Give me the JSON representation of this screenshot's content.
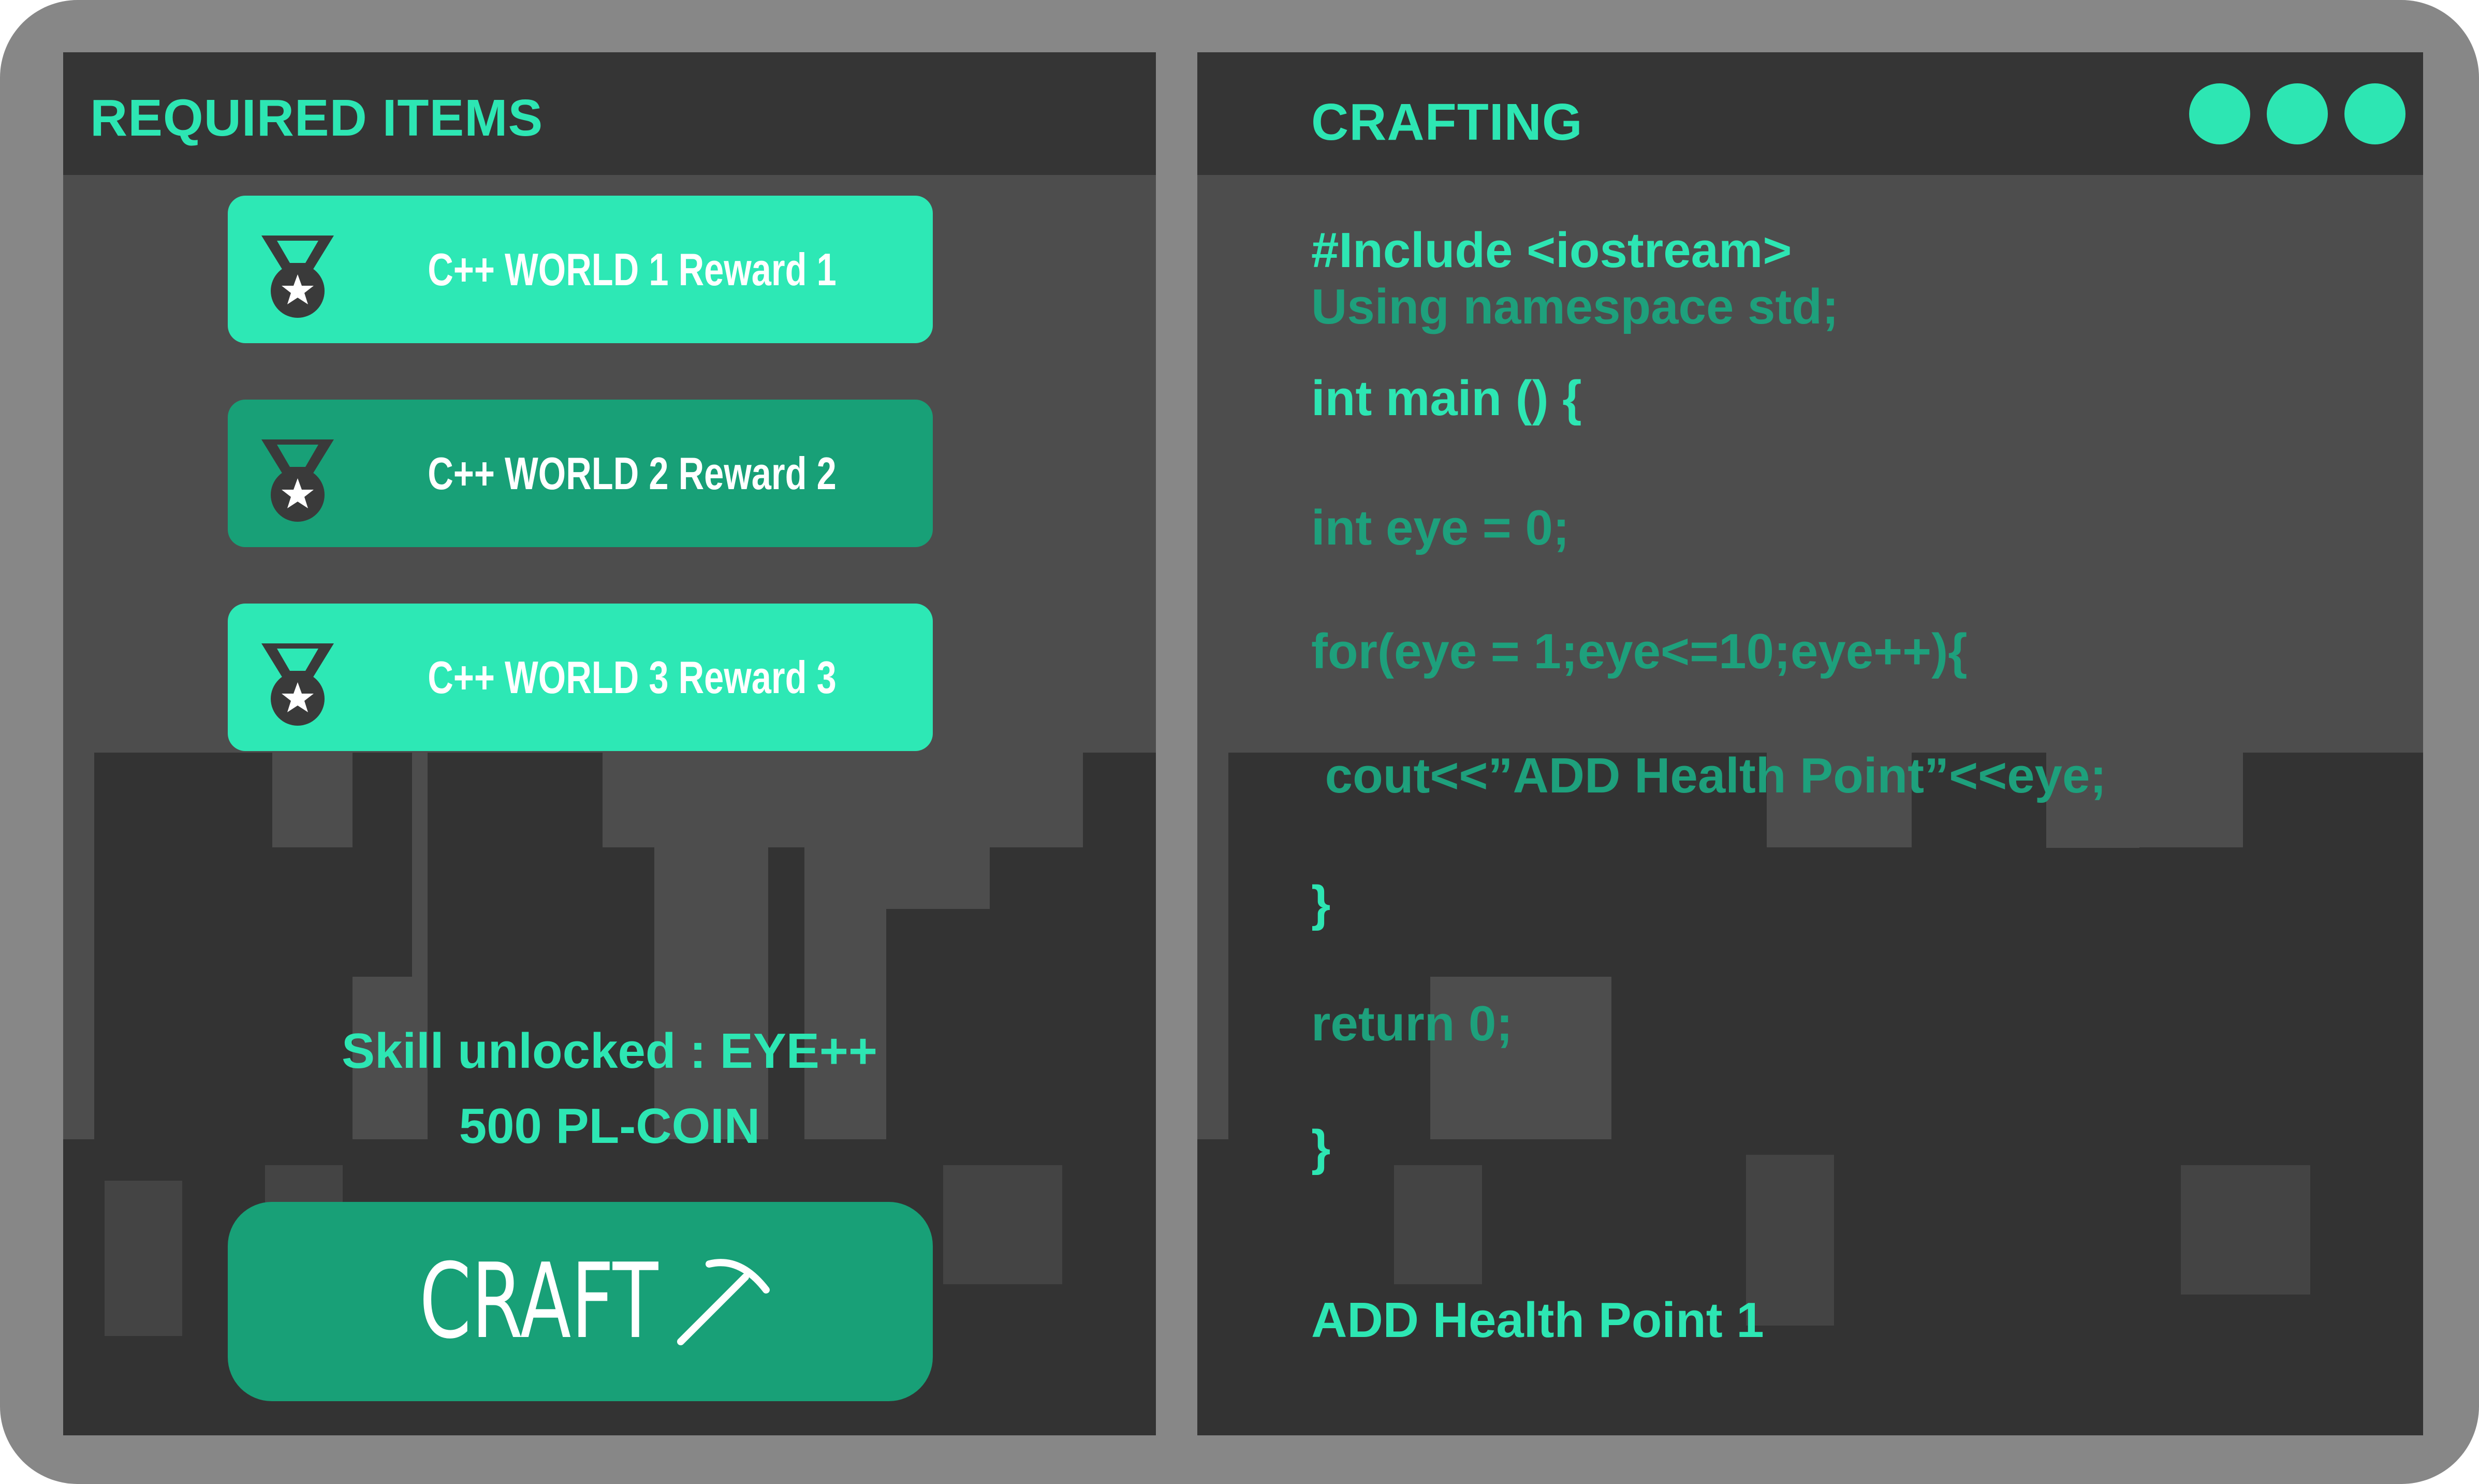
{
  "required_panel": {
    "title": "REQUIRED ITEMS",
    "items": [
      {
        "label": "C++ WORLD 1 Reward 1",
        "icon": "medal-icon",
        "style": "active"
      },
      {
        "label": "C++ WORLD 2 Reward 2",
        "icon": "medal-icon",
        "style": "inactive"
      },
      {
        "label": "C++ WORLD 3 Reward 3",
        "icon": "medal-icon",
        "style": "active"
      }
    ],
    "skill_text": "Skill unlocked : EYE++",
    "coin_text": "500 PL-COIN",
    "craft_button": {
      "label": "CRAFT",
      "icon": "pickaxe-icon"
    }
  },
  "crafting_panel": {
    "title": "CRAFTING",
    "window_controls": [
      "dot-button",
      "dot-button",
      "dot-button"
    ],
    "code_lines": [
      "#Include <iostream>",
      "Using namespace std;",
      "int main () {",
      "int eye = 0;",
      "for(eye = 1;eye<=10;eye++){",
      " cout<<”ADD Health Point”<<eye;",
      "}",
      "return 0;",
      "}"
    ],
    "output": "ADD Health Point 1"
  },
  "colors": {
    "frame": "#878787",
    "panel": "#4d4d4d",
    "header": "#353535",
    "skyline": "#333333",
    "accent": "#2de6b3",
    "accent_dark": "#18a077",
    "code_dim": "#1ea07c"
  }
}
